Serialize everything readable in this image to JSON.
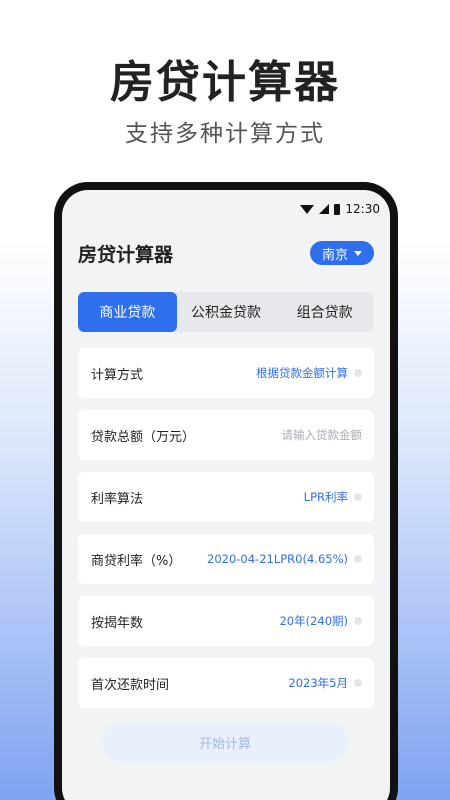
{
  "promo": {
    "title": "房贷计算器",
    "subtitle": "支持多种计算方式"
  },
  "status_bar": {
    "time": "12:30",
    "icons": [
      "wifi-icon",
      "signal-icon",
      "battery-icon"
    ]
  },
  "header": {
    "title": "房贷计算器",
    "city": "南京"
  },
  "tabs": [
    {
      "label": "商业贷款",
      "active": true
    },
    {
      "label": "公积金贷款",
      "active": false
    },
    {
      "label": "组合贷款",
      "active": false
    }
  ],
  "form": {
    "calc_method": {
      "label": "计算方式",
      "value": "根据贷款金额计算"
    },
    "loan_amount": {
      "label": "贷款总额（万元）",
      "placeholder": "请输入贷款金额"
    },
    "rate_method": {
      "label": "利率算法",
      "value": "LPR利率"
    },
    "commercial_rate": {
      "label": "商贷利率（%）",
      "value": "2020-04-21LPR0(4.65%)"
    },
    "years": {
      "label": "按揭年数",
      "value": "20年(240期)"
    },
    "first_payment": {
      "label": "首次还款时间",
      "value": "2023年5月"
    }
  },
  "actions": {
    "start_label": "开始计算"
  },
  "colors": {
    "accent": "#2f6fed",
    "screen_bg": "#f2f3f5",
    "value_text": "#2f6fed",
    "placeholder_text": "#a8abb2",
    "button_disabled_bg": "#e9f0fc"
  }
}
